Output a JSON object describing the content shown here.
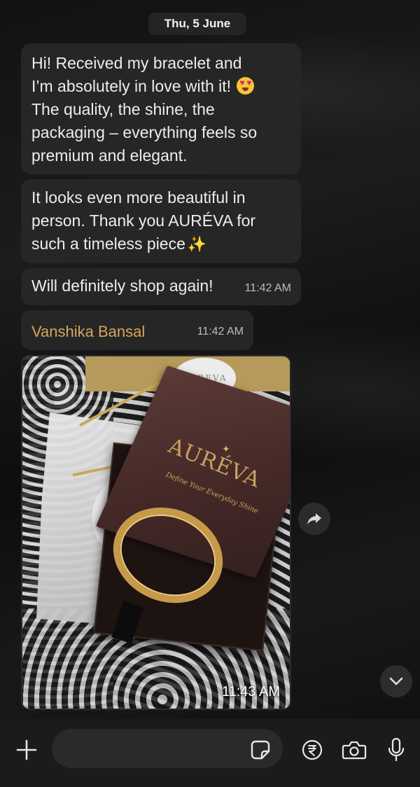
{
  "date_separator": "Thu, 5 June",
  "messages": [
    {
      "lines": [
        "Hi! Received my bracelet and",
        "I’m absolutely in love with it!",
        "The quality, the shine, the",
        "packaging – everything feels so",
        "premium and elegant."
      ],
      "emoji": "heart-eyes-emoji"
    },
    {
      "lines": [
        "It looks even more beautiful in",
        "person. Thank you AURÉVA for",
        "such a timeless piece"
      ],
      "emoji": "sparkles-emoji"
    },
    {
      "text": "Will definitely shop again!",
      "time": "11:42 AM"
    },
    {
      "sender": "Vanshika Bansal",
      "time": "11:42 AM"
    }
  ],
  "image_message": {
    "brand": "AURÉVA",
    "tagline": "Define Your Everyday Shine",
    "seal_text": "AUREVA",
    "seal_text_2": "AUREVA",
    "time": "11:43 AM"
  },
  "composer": {
    "placeholder": "",
    "icons": [
      "plus-icon",
      "sticker-icon",
      "rupee-payment-icon",
      "camera-icon",
      "microphone-icon"
    ]
  },
  "colors": {
    "bubble": "#262626",
    "sender_name": "#d7a55b",
    "background": "#121212",
    "composer": "#1b1b1b"
  }
}
